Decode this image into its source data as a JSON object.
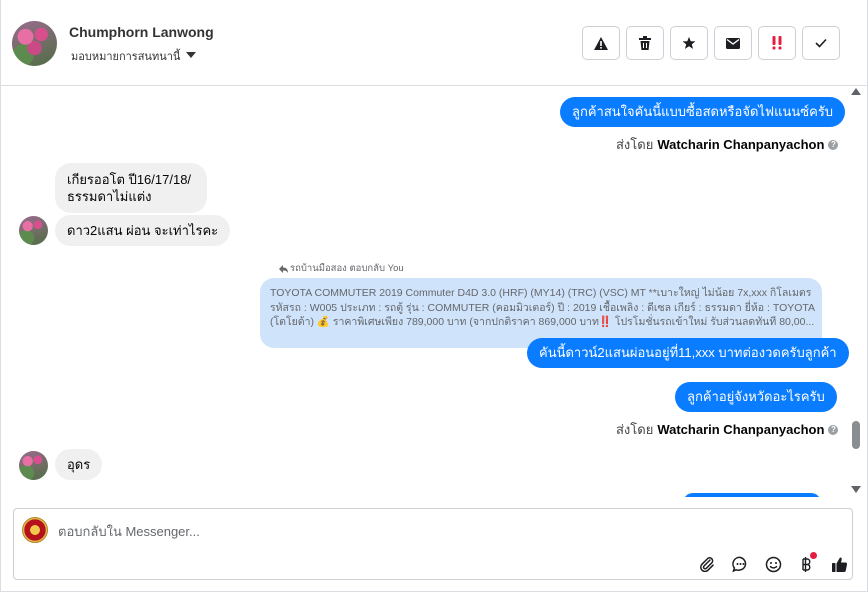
{
  "header": {
    "user_name": "Chumphorn Lanwong",
    "assign_label": "มอบหมายการสนทนานี้"
  },
  "messages": {
    "out1": "ลูกค้าสนใจคันนี้แบบซื้อสดหรือจัดไฟแนนซ์ครับ",
    "sent_by_prefix": "ส่งโดย",
    "sent_by_name": "Watcharin Chanpanyachon",
    "in1_line1": "เกียรออโต  ปี16/17/18/",
    "in1_line2": "ธรรมดาไม่แต่ง",
    "in2": "ดาว2แสน  ผ่อน จะเท่าไรคะ",
    "reply_label": "รถบ้านมือสอง ตอบกลับ You",
    "quoted_line1": "TOYOTA COMMUTER 2019 Commuter D4D 3.0 (HRF) (MY14) (TRC) (VSC) MT **เบาะใหญ่ ไม่น้อย 7x,xxx กิโลเมตร",
    "quoted_line2": "รหัสรถ : W005 ประเภท : รถตู้ รุ่น : COMMUTER (คอมมิวเตอร์) ปี : 2019 เชื้อเพลิง : ดีเซล เกียร์ : ธรรมดา ยี่ห้อ : TOYOTA",
    "quoted_line3": "(โตโยต้า) 💰 ราคาพิเศษเพียง 789,000 บาท (จากปกติราคา 869,000 บาท‼️ โปรโมชั่นรถเข้าใหม่ รับส่วนลดทันที 80,00...",
    "out2": "คันนี้ดาวน์2แสนผ่อนอยู่ที่11,xxx บาทต่องวดครับลูกค้า",
    "out3": "ลูกค้าอยู่จังหวัดอะไรครับ",
    "in3": "อุดร"
  },
  "composer": {
    "placeholder": "ตอบกลับใน Messenger...",
    "value": ""
  },
  "icons": {
    "actions": [
      "warning-icon",
      "trash-icon",
      "star-icon",
      "mail-icon",
      "urgent-icon",
      "check-icon"
    ],
    "tools": [
      "attach-icon",
      "chat-bubble-icon",
      "emoji-icon",
      "baht-icon",
      "thumbs-up-icon"
    ]
  },
  "colors": {
    "accent": "#0a7cff",
    "urgent": "#e41e3f",
    "quoted_bg": "#cfe3fb"
  }
}
